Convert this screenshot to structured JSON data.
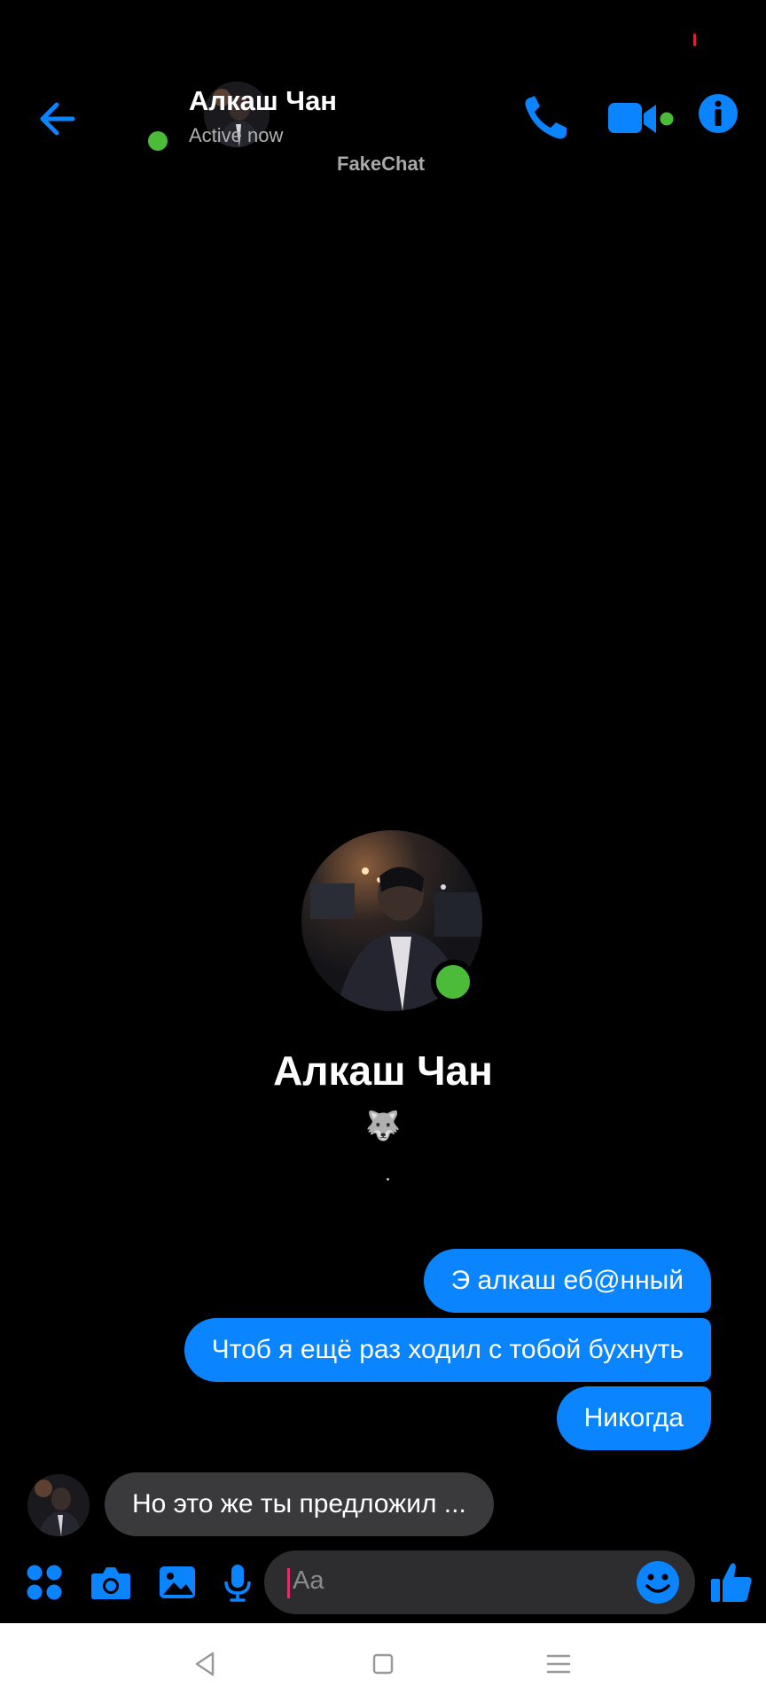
{
  "contact": {
    "name": "Алкаш Чан",
    "status": "Active now"
  },
  "watermark": "FakeChat",
  "profile": {
    "name": "Алкаш Чан",
    "emoji": "🐺"
  },
  "messages": [
    {
      "direction": "outgoing",
      "text": "Э алкаш еб@нный"
    },
    {
      "direction": "outgoing",
      "text": "Чтоб я ещё раз ходил с тобой бухнуть"
    },
    {
      "direction": "outgoing",
      "text": "Никогда"
    },
    {
      "direction": "incoming",
      "text": "Но это же ты предложил ..."
    }
  ],
  "composer": {
    "placeholder": "Aa"
  },
  "icons": {
    "back": "arrow-left-icon",
    "call": "phone-icon",
    "video": "video-camera-icon",
    "info": "info-icon",
    "apps": "grid-dots-icon",
    "camera": "camera-icon",
    "gallery": "image-icon",
    "mic": "microphone-icon",
    "emoji": "smiley-icon",
    "like": "thumbs-up-icon"
  },
  "colors": {
    "accent": "#0a84ff",
    "online": "#4cbb3a",
    "background": "#000000",
    "incoming_bubble": "#3a3a3c"
  }
}
